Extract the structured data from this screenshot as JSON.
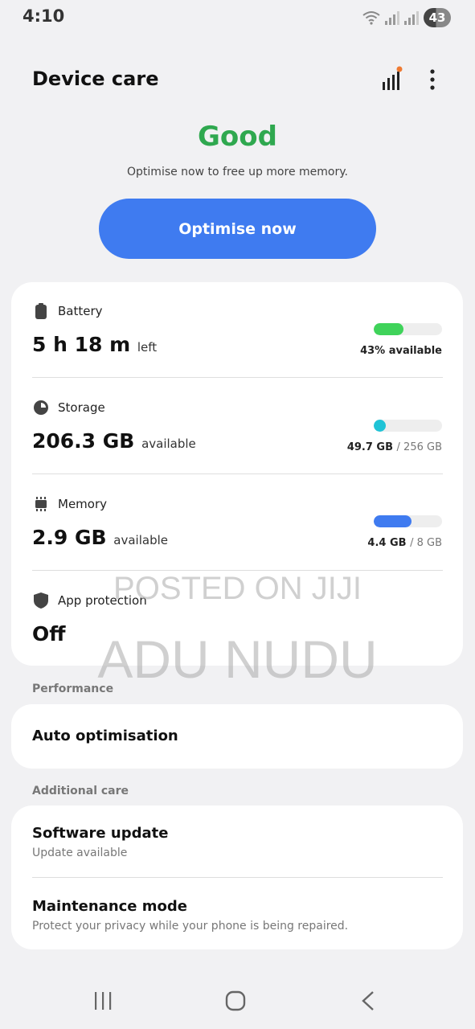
{
  "status_bar": {
    "time": "4:10",
    "battery_level": "43"
  },
  "header": {
    "title": "Device care",
    "icons": [
      "bar-chart-icon",
      "more-options-icon"
    ]
  },
  "summary": {
    "status": "Good",
    "status_color": "#2fa84f",
    "message": "Optimise now to free up more memory.",
    "button_label": "Optimise now",
    "button_color": "#3f7bf0"
  },
  "battery": {
    "label": "Battery",
    "value": "5 h 18 m",
    "unit": "left",
    "bar_fraction": 0.43,
    "bar_color": "#3fd35a",
    "detail": "43% available"
  },
  "storage": {
    "label": "Storage",
    "value": "206.3 GB",
    "unit": "available",
    "bar_fraction": 0.194,
    "bar_color": "#1fc3d6",
    "used": "49.7 GB",
    "total": "/ 256 GB"
  },
  "memory": {
    "label": "Memory",
    "value": "2.9 GB",
    "unit": "available",
    "bar_fraction": 0.55,
    "bar_color": "#3f7bf0",
    "used": "4.4 GB",
    "total": "/ 8 GB"
  },
  "app_protection": {
    "label": "App protection",
    "value": "Off"
  },
  "performance": {
    "section_label": "Performance",
    "auto_optimisation": "Auto optimisation"
  },
  "additional_care": {
    "section_label": "Additional care",
    "software_update_title": "Software update",
    "software_update_sub": "Update available",
    "maintenance_title": "Maintenance mode",
    "maintenance_sub": "Protect your privacy while your phone is being repaired."
  },
  "watermark": {
    "line1": "POSTED ON JIJI",
    "line2": "ADU NUDU"
  },
  "navbar": {
    "icons": [
      "recent-apps-icon",
      "home-icon",
      "back-icon"
    ]
  }
}
